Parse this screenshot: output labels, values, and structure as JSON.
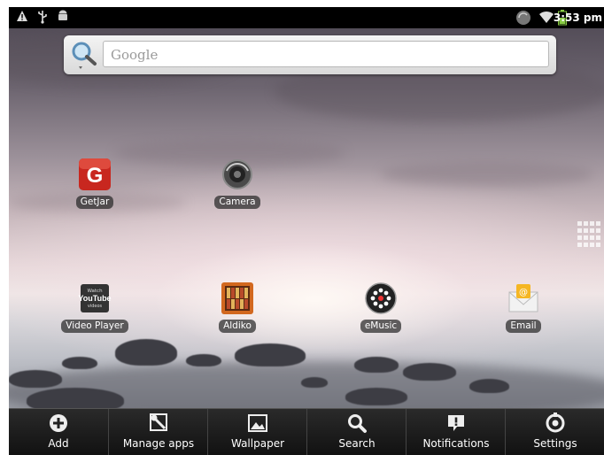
{
  "status_bar": {
    "left_icons": [
      "warning-icon",
      "usb-icon",
      "android-debug-icon"
    ],
    "right_icons": [
      "sync-icon",
      "wifi-icon",
      "battery-icon"
    ],
    "time": "3:53 pm"
  },
  "search": {
    "placeholder": "Google"
  },
  "home_apps": [
    {
      "label": "GetJar",
      "icon": "getjar-icon"
    },
    {
      "label": "Camera",
      "icon": "camera-icon"
    },
    {
      "label": "Video Player",
      "icon": "youtube-icon",
      "badge_lines": [
        "Watch",
        "YouTube",
        "videos"
      ]
    },
    {
      "label": "Aldiko",
      "icon": "aldiko-icon"
    },
    {
      "label": "eMusic",
      "icon": "emusic-icon"
    },
    {
      "label": "Email",
      "icon": "email-icon"
    }
  ],
  "getjar_letter": "G",
  "menu": [
    {
      "label": "Add",
      "icon": "plus-icon"
    },
    {
      "label": "Manage apps",
      "icon": "wrench-icon"
    },
    {
      "label": "Wallpaper",
      "icon": "picture-icon"
    },
    {
      "label": "Search",
      "icon": "magnifier-icon"
    },
    {
      "label": "Notifications",
      "icon": "notification-icon"
    },
    {
      "label": "Settings",
      "icon": "settings-icon"
    }
  ]
}
